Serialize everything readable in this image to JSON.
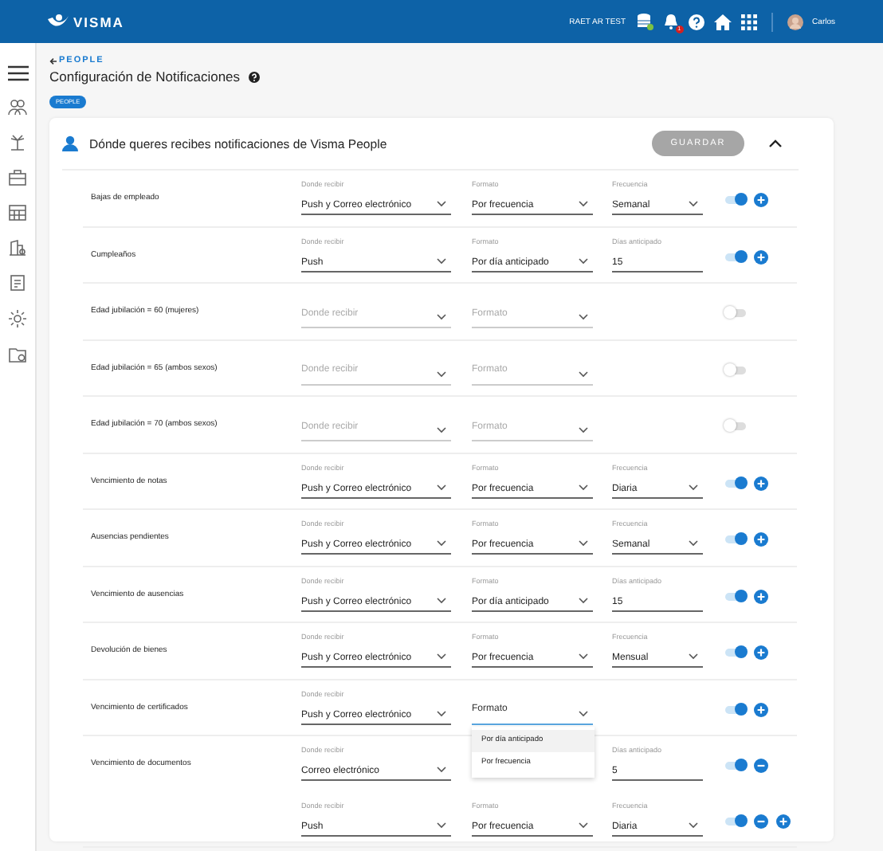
{
  "topbar": {
    "logo": "VISMA",
    "environment": "RAET AR TEST",
    "notification_count": "1",
    "user": "Carlos"
  },
  "breadcrumb": "PEOPLE",
  "title": "Configuración de Notificaciones",
  "tag": "PEOPLE",
  "card": {
    "title": "Dónde queres recibes notificaciones de Visma People",
    "save_button": "GUARDAR",
    "save_disabled": true,
    "expanded": true
  },
  "rows": [
    {
      "label": "Bajas de empleado",
      "lines": [
        {
          "channel": {
            "label": "Donde recibir",
            "value": "Push y Correo electrónico"
          },
          "format": {
            "label": "Formato",
            "value": "Por frecuencia"
          },
          "detail": {
            "kind": "select",
            "label": "Frecuencia",
            "value": "Semanal"
          },
          "on": true,
          "can_add": true,
          "can_remove": false
        }
      ]
    },
    {
      "label": "Cumpleaños",
      "lines": [
        {
          "channel": {
            "label": "Donde recibir",
            "value": "Push"
          },
          "format": {
            "label": "Formato",
            "value": "Por día anticipado"
          },
          "detail": {
            "kind": "number",
            "label": "Días anticipado",
            "value": "15"
          },
          "on": true,
          "can_add": true,
          "can_remove": false
        }
      ]
    },
    {
      "label": "Edad jubilación = 60 (mujeres)",
      "lines": [
        {
          "channel": {
            "placeholder": "Donde recibir"
          },
          "format": {
            "placeholder": "Formato"
          },
          "on": false
        }
      ]
    },
    {
      "label": "Edad jubilación = 65 (ambos sexos)",
      "lines": [
        {
          "channel": {
            "placeholder": "Donde recibir"
          },
          "format": {
            "placeholder": "Formato"
          },
          "on": false
        }
      ]
    },
    {
      "label": "Edad jubilación = 70 (ambos sexos)",
      "lines": [
        {
          "channel": {
            "placeholder": "Donde recibir"
          },
          "format": {
            "placeholder": "Formato"
          },
          "on": false
        }
      ]
    },
    {
      "label": "Vencimiento de notas",
      "lines": [
        {
          "channel": {
            "label": "Donde recibir",
            "value": "Push y Correo electrónico"
          },
          "format": {
            "label": "Formato",
            "value": "Por frecuencia"
          },
          "detail": {
            "kind": "select",
            "label": "Frecuencia",
            "value": "Diaria"
          },
          "on": true,
          "can_add": true,
          "can_remove": false
        }
      ]
    },
    {
      "label": "Ausencias pendientes",
      "lines": [
        {
          "channel": {
            "label": "Donde recibir",
            "value": "Push y Correo electrónico"
          },
          "format": {
            "label": "Formato",
            "value": "Por frecuencia"
          },
          "detail": {
            "kind": "select",
            "label": "Frecuencia",
            "value": "Semanal"
          },
          "on": true,
          "can_add": true,
          "can_remove": false
        }
      ]
    },
    {
      "label": "Vencimiento de ausencias",
      "lines": [
        {
          "channel": {
            "label": "Donde recibir",
            "value": "Push y Correo electrónico"
          },
          "format": {
            "label": "Formato",
            "value": "Por día anticipado"
          },
          "detail": {
            "kind": "number",
            "label": "Días anticipado",
            "value": "15"
          },
          "on": true,
          "can_add": true,
          "can_remove": false
        }
      ]
    },
    {
      "label": "Devolución de bienes",
      "lines": [
        {
          "channel": {
            "label": "Donde recibir",
            "value": "Push y Correo electrónico"
          },
          "format": {
            "label": "Formato",
            "value": "Por frecuencia"
          },
          "detail": {
            "kind": "select",
            "label": "Frecuencia",
            "value": "Mensual"
          },
          "on": true,
          "can_add": true,
          "can_remove": false
        }
      ]
    },
    {
      "label": "Vencimiento de certificados",
      "lines": [
        {
          "channel": {
            "label": "Donde recibir",
            "value": "Push y Correo electrónico"
          },
          "format": {
            "placeholder": "Formato",
            "open": true,
            "options": [
              {
                "label": "Por día anticipado",
                "highlighted": true
              },
              {
                "label": "Por frecuencia",
                "highlighted": false
              }
            ]
          },
          "on": true,
          "can_add": true,
          "can_remove": false
        }
      ]
    },
    {
      "label": "Vencimiento de documentos",
      "lines": [
        {
          "channel": {
            "label": "Donde recibir",
            "value": "Correo electrónico"
          },
          "detail": {
            "kind": "number",
            "label": "Días anticipado",
            "value": "5"
          },
          "on": true,
          "can_add": false,
          "can_remove": true
        },
        {
          "channel": {
            "label": "Donde recibir",
            "value": "Push"
          },
          "format": {
            "label": "Formato",
            "value": "Por frecuencia"
          },
          "detail": {
            "kind": "select",
            "label": "Frecuencia",
            "value": "Diaria"
          },
          "on": true,
          "can_add": true,
          "can_remove": true
        }
      ]
    }
  ]
}
